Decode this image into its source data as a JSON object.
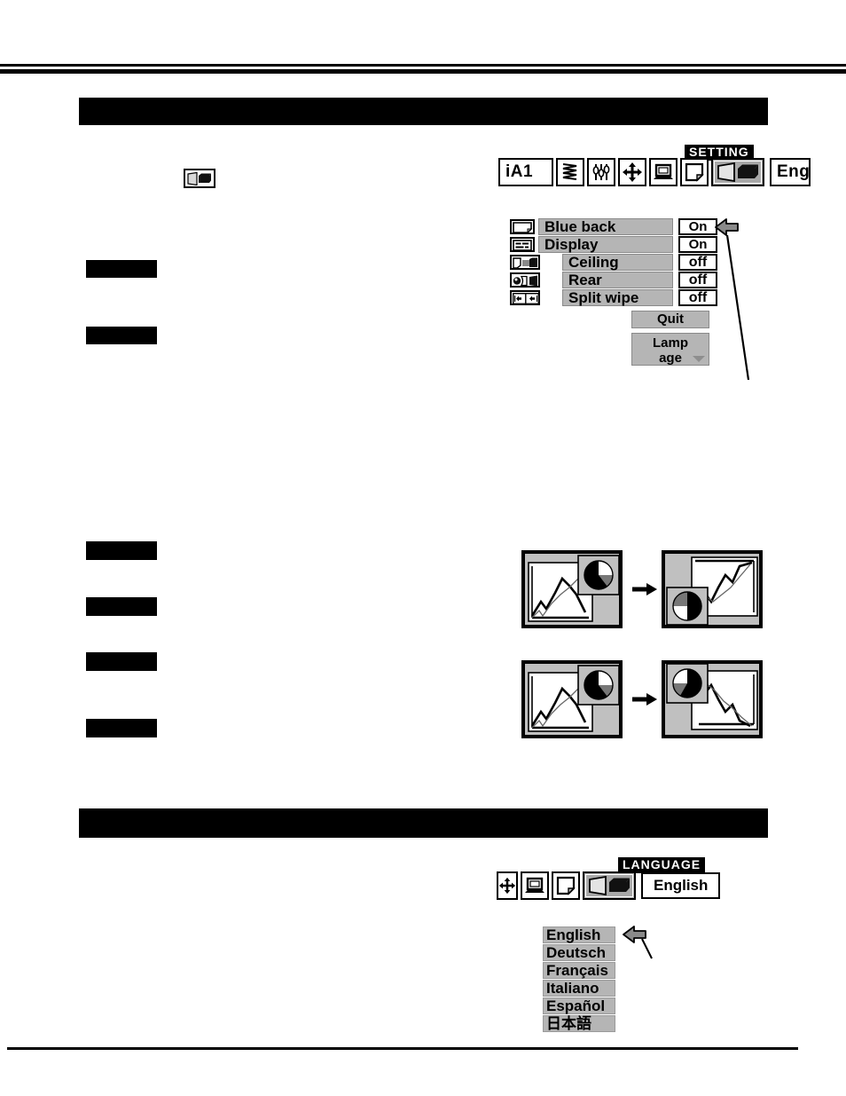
{
  "document": {
    "type": "projector-manual-page"
  },
  "sections": [
    {
      "id": "setting",
      "bar_label": ""
    },
    {
      "id": "language",
      "bar_label": ""
    }
  ],
  "toolbar_setting": {
    "input_value": "iA1",
    "caption": "SETTING",
    "right_value": "Eng",
    "icons": [
      {
        "name": "pc-adjust-icon",
        "glyph": "zigzag"
      },
      {
        "name": "image-adjust-icon",
        "glyph": "sliders"
      },
      {
        "name": "image-select-icon",
        "glyph": "four-arrows"
      },
      {
        "name": "screen-adjust-icon",
        "glyph": "monitor"
      },
      {
        "name": "sound-icon",
        "glyph": "page-curl"
      },
      {
        "name": "setting-icon",
        "glyph": "projector",
        "selected": true
      }
    ]
  },
  "inline_icon": {
    "name": "setting-icon",
    "glyph": "projector"
  },
  "setting_menu": {
    "rows": [
      {
        "icon": "blue-back-icon",
        "label": "Blue back",
        "value": "On",
        "indent": false
      },
      {
        "icon": "display-icon",
        "label": "Display",
        "value": "On",
        "indent": false
      },
      {
        "icon": "ceiling-icon",
        "label": "Ceiling",
        "value": "off",
        "indent": true
      },
      {
        "icon": "rear-icon",
        "label": "Rear",
        "value": "off",
        "indent": true
      },
      {
        "icon": "split-wipe-icon",
        "label": "Split  wipe",
        "value": "off",
        "indent": true
      }
    ],
    "quit_label": "Quit",
    "lamp_age_line1": "Lamp",
    "lamp_age_line2": "age"
  },
  "toolbar_language": {
    "caption": "LANGUAGE",
    "value": "English",
    "icons": [
      {
        "name": "image-select-icon",
        "glyph": "four-arrows"
      },
      {
        "name": "screen-adjust-icon",
        "glyph": "monitor"
      },
      {
        "name": "sound-icon",
        "glyph": "page-curl"
      },
      {
        "name": "setting-icon",
        "glyph": "projector",
        "selected": true
      }
    ]
  },
  "language_list": {
    "items": [
      {
        "label": "English",
        "selected": true
      },
      {
        "label": "Deutsch",
        "selected": false
      },
      {
        "label": "Français",
        "selected": false
      },
      {
        "label": "Italiano",
        "selected": false
      },
      {
        "label": "Español",
        "selected": false
      },
      {
        "label": "日本語",
        "selected": false
      }
    ]
  },
  "colors": {
    "menu_gray": "#b5b5b5",
    "figure_gray": "#c0c0c0",
    "selected_icon_gray": "#a8a8a8",
    "ink": "#000000",
    "paper": "#ffffff"
  },
  "figures": {
    "split_wipe_upper": {
      "name": "split-wipe-horizontal-diagram",
      "arrow": "→"
    },
    "split_wipe_lower": {
      "name": "split-wipe-vertical-diagram",
      "arrow": "→"
    }
  }
}
